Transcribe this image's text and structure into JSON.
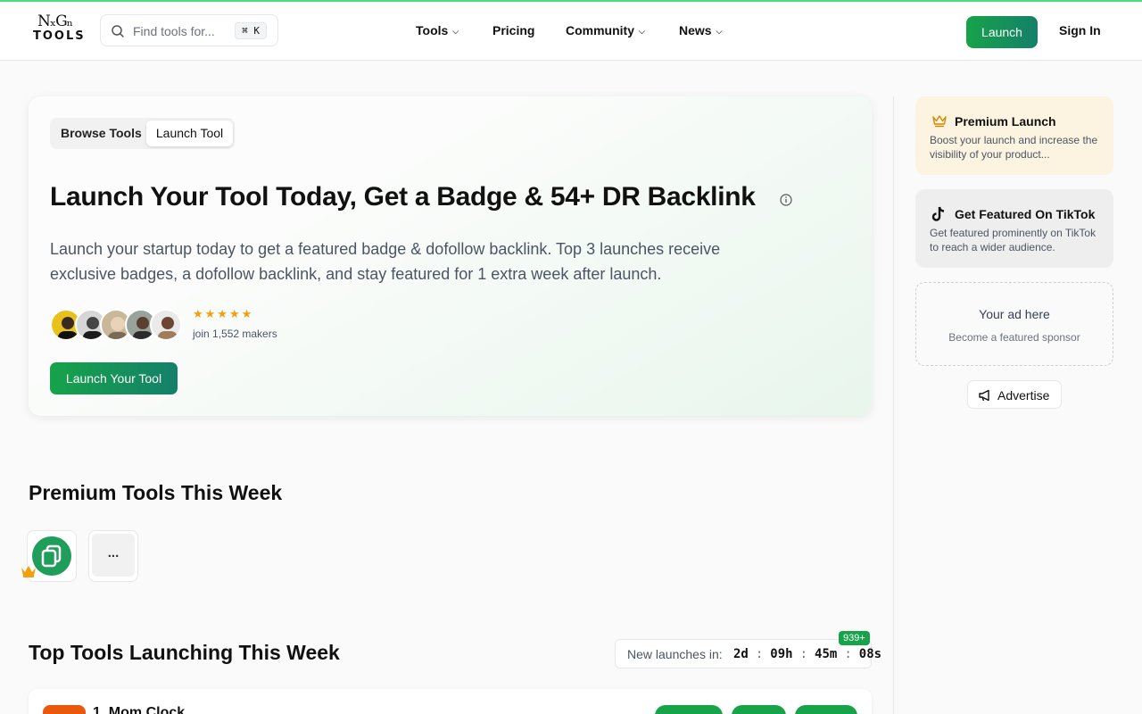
{
  "header": {
    "logo": {
      "line1": "NₓGₙ",
      "line2": "TOOLS"
    },
    "search_placeholder": "Find tools for...",
    "search_shortcut": "⌘ K",
    "nav": [
      {
        "label": "Tools",
        "has_dropdown": true
      },
      {
        "label": "Pricing",
        "has_dropdown": false
      },
      {
        "label": "Community",
        "has_dropdown": true
      },
      {
        "label": "News",
        "has_dropdown": true
      }
    ],
    "launch_label": "Launch",
    "signin_label": "Sign In"
  },
  "hero": {
    "tabs": [
      "Browse Tools",
      "Launch Tool"
    ],
    "active_tab": "Launch Tool",
    "title": "Launch Your Tool Today, Get a Badge & 54+ DR Backlink",
    "description": "Launch your startup today to get a featured badge & dofollow backlink. Top 3 launches receive exclusive badges, a dofollow backlink, and stay featured for 1 extra week after launch.",
    "rating_stars": 5,
    "stars_text": "★★★★★",
    "join_text": "join 1,552 makers",
    "cta_label": "Launch Your Tool"
  },
  "premium": {
    "heading": "Premium Tools This Week",
    "more_label": "..."
  },
  "top_tools": {
    "heading": "Top Tools Launching This Week",
    "countdown_label": "New launches in:",
    "countdown": [
      "2d",
      "09h",
      "45m",
      "08s"
    ],
    "badge": "939+",
    "first_item": "1. Mom Clock"
  },
  "sidebar": {
    "premium_launch": {
      "title": "Premium Launch",
      "text": "Boost your launch and increase the visibility of your product..."
    },
    "tiktok": {
      "title": "Get Featured On TikTok",
      "text": "Get featured prominently on TikTok to reach a wider audience."
    },
    "ad": {
      "title": "Your ad here",
      "subtitle": "Become a featured sponsor"
    },
    "advertise_label": "Advertise"
  },
  "colors": {
    "brand_green": "#16a34a",
    "premium_bg": "#fcf4e0",
    "tiktok_bg": "#eeeeee",
    "star": "#f59e0b"
  }
}
